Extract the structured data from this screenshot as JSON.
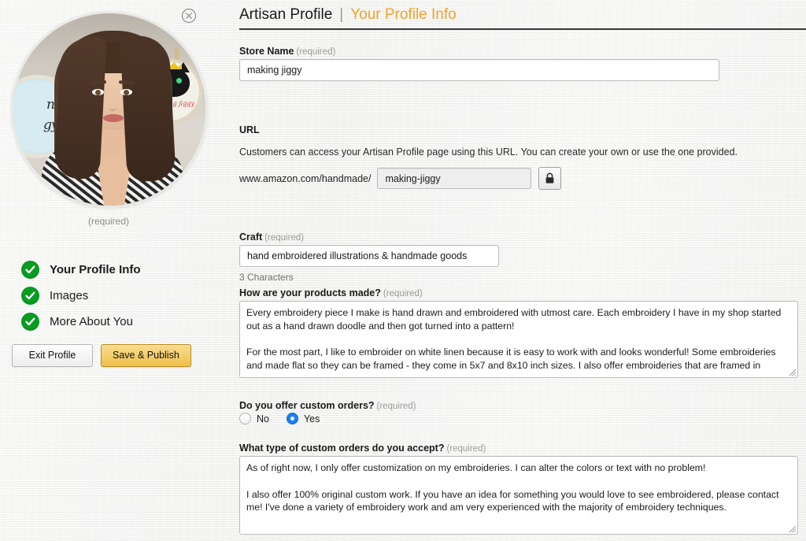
{
  "header": {
    "title": "Artisan Profile",
    "separator": "|",
    "subtitle": "Your Profile Info"
  },
  "sidebar": {
    "avatar_caption": "(required)",
    "close_label": "×",
    "checklist": [
      {
        "label": "Your Profile Info",
        "complete": true,
        "active": true
      },
      {
        "label": "Images",
        "complete": true,
        "active": false
      },
      {
        "label": "More About You",
        "complete": true,
        "active": false
      }
    ],
    "buttons": {
      "exit": "Exit Profile",
      "save": "Save & Publish"
    }
  },
  "form": {
    "store_name": {
      "label": "Store Name",
      "required": "(required)",
      "value": "making jiggy"
    },
    "url": {
      "label": "URL",
      "helper": "Customers can access your Artisan Profile page using this URL. You can create your own or use the one provided.",
      "prefix": "www.amazon.com/handmade/",
      "value": "making-jiggy",
      "lock_icon": "lock-icon"
    },
    "craft": {
      "label": "Craft",
      "required": "(required)",
      "value": "hand embroidered illustrations & handmade goods",
      "counter": "3 Characters"
    },
    "products_made": {
      "label": "How are your products made?",
      "required": "(required)",
      "value": "Every embroidery piece I make is hand drawn and embroidered with utmost care. Each embroidery I have in my shop started out as a hand drawn doodle and then got turned into a pattern!\n\nFor the most part, I like to embroider on white linen because it is easy to work with and looks wonderful! Some embroideries and made flat so they can be framed - they come in 5x7 and 8x10 inch sizes. I also offer embroideries that are framed in"
    },
    "custom_orders": {
      "label": "Do you offer custom orders?",
      "required": "(required)",
      "options": [
        {
          "label": "No",
          "selected": false
        },
        {
          "label": "Yes",
          "selected": true
        }
      ]
    },
    "custom_orders_type": {
      "label": "What type of custom orders do you accept?",
      "required": "(required)",
      "value": "As of right now, I only offer customization on my embroideries. I can alter the colors or text with no problem!\n\nI also offer 100% original custom work. If you have an idea for something you would love to see embroidered, please contact me! I've done a variety of embroidery work and am very experienced with the majority of embroidery techniques."
    }
  },
  "colors": {
    "accent_orange": "#f2a32a",
    "check_green": "#0a9b22",
    "radio_blue": "#1a7ff0",
    "save_button": "#efbf4a",
    "background": "#f3f3f1"
  }
}
